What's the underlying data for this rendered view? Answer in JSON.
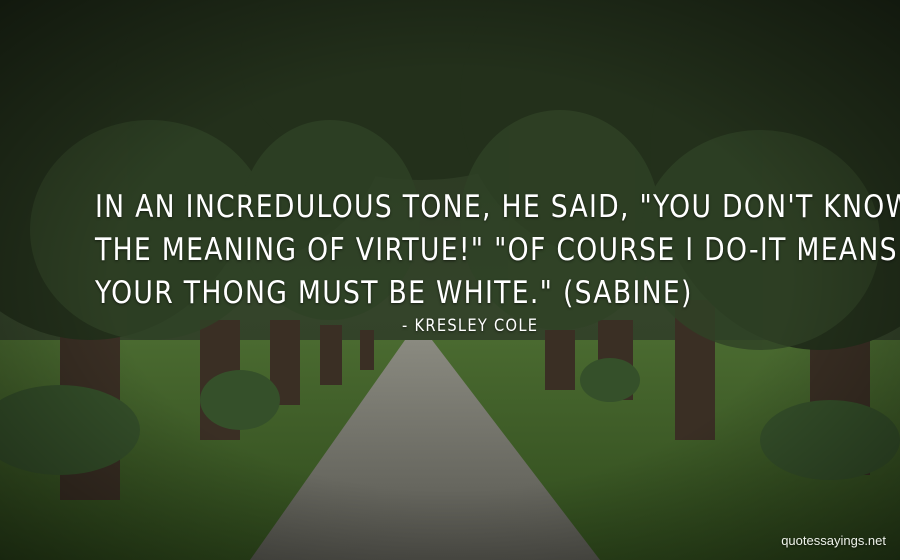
{
  "quote": {
    "lines": [
      "In an incredulous tone, he said, \"You don't know",
      "the meaning of virtue!\" \"Of course I do-it means",
      "your thong must be white.\" (Sabine)"
    ],
    "author": "- Kresley Cole"
  },
  "watermark": "quotessayings.net",
  "colors": {
    "text": "#ffffff",
    "foliage": "#2a3a22",
    "grass": "#3a5a24",
    "path": "#5f5f58"
  }
}
